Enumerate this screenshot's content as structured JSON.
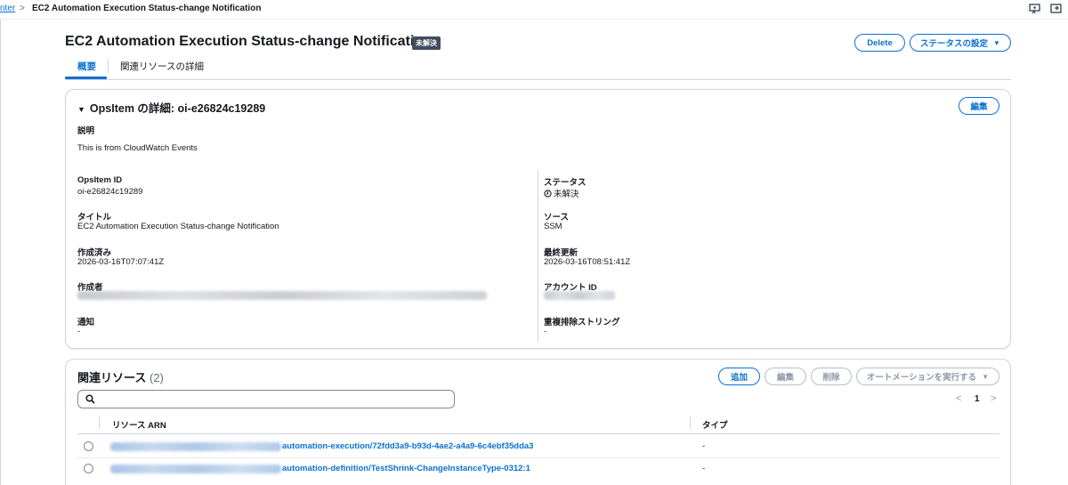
{
  "breadcrumb": {
    "parent": "nter",
    "current": "EC2 Automation Execution Status-change Notification"
  },
  "header": {
    "title": "EC2 Automation Execution Status-change Notification",
    "status_badge": "未解決",
    "delete_button": "Delete",
    "set_status_button": "ステータスの設定"
  },
  "tabs": [
    {
      "label": "概要",
      "active": true
    },
    {
      "label": "関連リソースの詳細",
      "active": false
    }
  ],
  "details": {
    "title": "OpsItem の詳細: oi-e26824c19289",
    "edit_button": "編集",
    "description_label": "説明",
    "description_value": "This is from CloudWatch Events",
    "left": [
      {
        "label": "OpsItem ID",
        "value": "oi-e26824c19289"
      },
      {
        "label": "タイトル",
        "value": "EC2 Automation Execution Status-change Notification"
      },
      {
        "label": "作成済み",
        "value": "2026-03-16T07:07:41Z"
      },
      {
        "label": "作成者",
        "value": ""
      },
      {
        "label": "通知",
        "value": "-"
      }
    ],
    "right": [
      {
        "label": "ステータス",
        "value": "未解決"
      },
      {
        "label": "ソース",
        "value": "SSM"
      },
      {
        "label": "最終更新",
        "value": "2026-03-16T08:51:41Z"
      },
      {
        "label": "アカウント ID",
        "value": ""
      },
      {
        "label": "重複排除ストリング",
        "value": "-"
      }
    ]
  },
  "related": {
    "title": "関連リソース",
    "count": "(2)",
    "add_button": "追加",
    "edit_button": "編集",
    "delete_button": "削除",
    "run_automation_button": "オートメーションを実行する",
    "search_placeholder": "",
    "page": "1",
    "columns": [
      "リソース ARN",
      "タイプ"
    ],
    "rows": [
      {
        "arn_suffix": "automation-execution/72fdd3a9-b93d-4ae2-a4a9-6c4ebf35dda3",
        "type": "-"
      },
      {
        "arn_suffix": "automation-definition/TestShrink-ChangeInstanceType-0312:1",
        "type": "-"
      }
    ]
  },
  "colors": {
    "accent": "#0972d3",
    "badge_bg": "#414d5c",
    "text": "#16191f",
    "border": "#d1d5db"
  }
}
